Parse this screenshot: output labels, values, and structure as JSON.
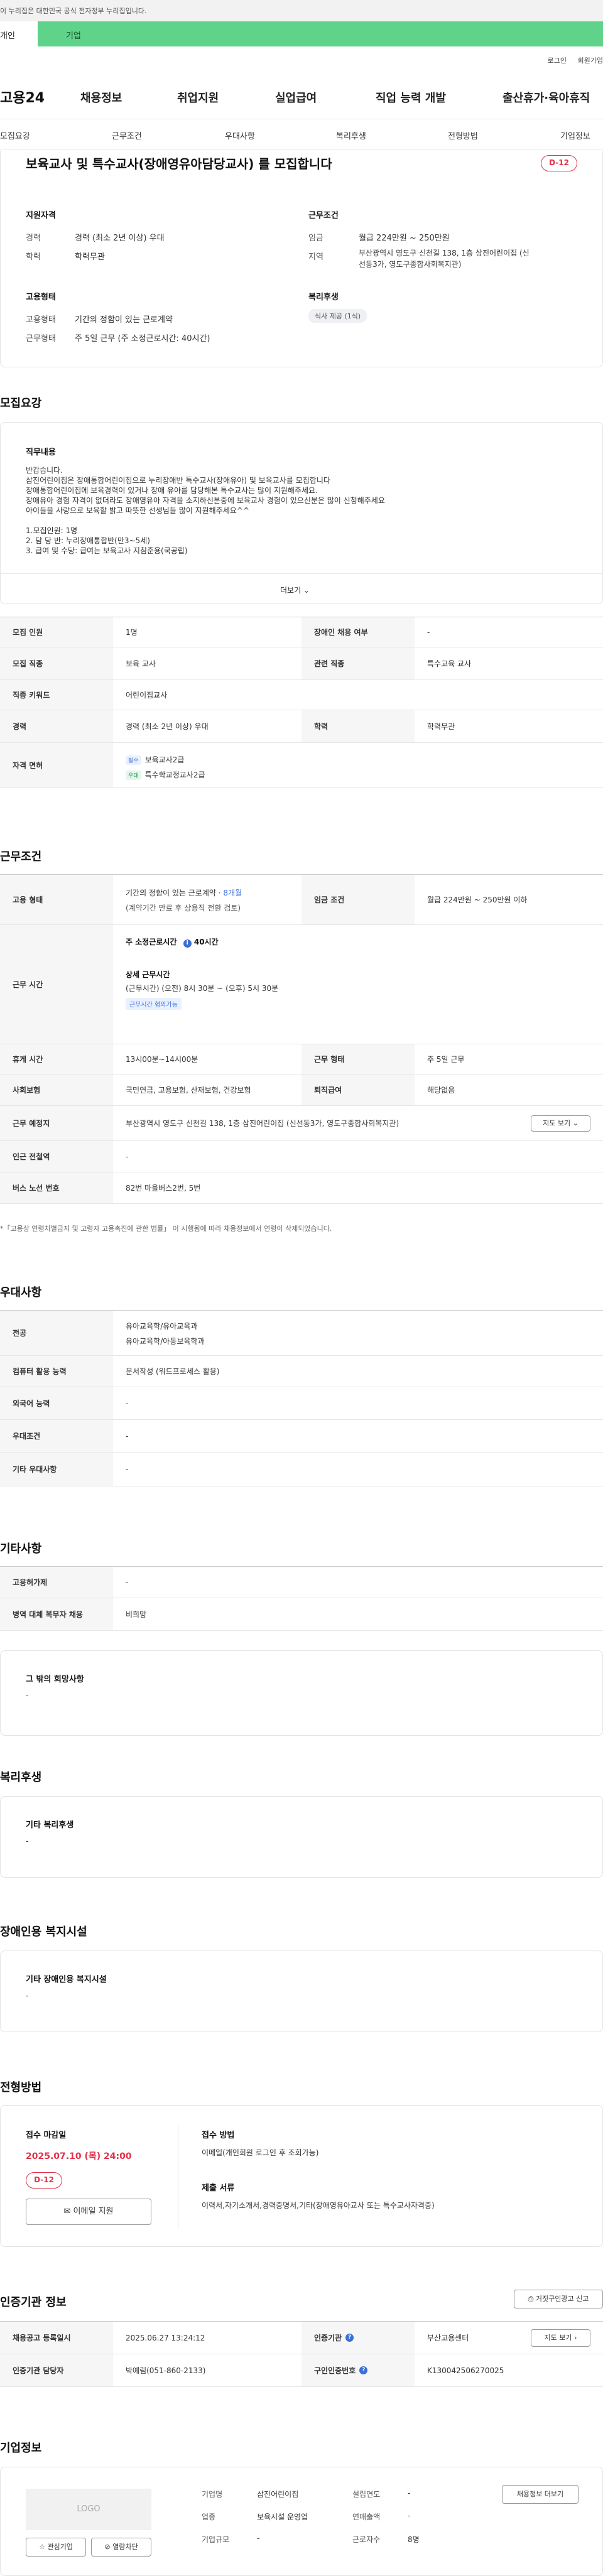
{
  "gov_banner": "이 누리집은 대한민국 공식 전자정부 누리집입니다.",
  "tabs": {
    "individual": "개인",
    "company": "기업"
  },
  "util_links": [
    "로그인",
    "회원가입"
  ],
  "brand": {
    "logo": "고용24"
  },
  "gnb": [
    "채용정보",
    "취업지원",
    "실업급여",
    "직업 능력 개발",
    "출산휴가·육아휴직"
  ],
  "anchor_nav": [
    "모집요강",
    "근무조건",
    "우대사항",
    "복리후생",
    "전형방법",
    "기업정보"
  ],
  "summary": {
    "title": "보육교사 및 특수교사(장애영유아담당교사) 를 모집합니다",
    "dday": "D-12",
    "qualification": {
      "heading": "지원자격",
      "career_label": "경력",
      "career": "경력 (최소 2년 이상) 우대",
      "edu_label": "학력",
      "edu": "학력무관"
    },
    "conditions": {
      "heading": "근무조건",
      "pay_label": "임금",
      "pay": "월급 224만원 ~ 250만원",
      "region_label": "지역",
      "region": "부산광역시 영도구 신천길 138, 1층 삼진어린이집 (신\n선동3가, 영도구종합사회복지관)"
    },
    "employment": {
      "heading": "고용형태",
      "type_label": "고용형태",
      "type": "기간의 정함이 있는 근로계약",
      "work_label": "근무형태",
      "work": "주 5일 근무 (주 소정근로시간: 40시간)"
    },
    "welfare": {
      "heading": "복리후생",
      "tag": "식사 제공 (1식)"
    }
  },
  "recruit": {
    "title": "모집요강",
    "box_heading": "직무내용",
    "content": "반갑습니다.\n삼진어린이집은 장애통합어린이집으로 누리장애반 특수교사(장애유아) 및 보육교사를 모집합니다\n장애통합어린이집에 보육경력이 있거나 장애 유아를 담당해본 특수교사는 많이 지원해주세요.\n장애유아 경험 자격이 없더라도 장애영유아 자격을 소지하신분중에 보육교사 경험이 있으신분은 많이 신청해주세요\n아이들을 사랑으로 보육할 밝고 따뜻한 선생님들 많이 지원해주세요^^\n\n1.모집인원: 1명\n2. 담 당 반: 누리장애통합반(만3~5세)\n3. 급여 및 수당: 급여는 보육교사 지침준용(국공립)",
    "more": "더보기",
    "rows": {
      "headcount_label": "모집 인원",
      "headcount": "1명",
      "disabled_label": "장애인 채용 여부",
      "disabled": "-",
      "job_label": "모집 직종",
      "job": "보육 교사",
      "related_label": "관련 직종",
      "related": "특수교육 교사",
      "keyword_label": "직종 키워드",
      "keyword": "어린이집교사",
      "career_label": "경력",
      "career": "경력 (최소 2년 이상) 우대",
      "edu_label": "학력",
      "edu": "학력무관",
      "license_label": "자격 면허",
      "license_badge_1": "필수",
      "license_1": "보육교사2급",
      "license_badge_2": "우대",
      "license_2": "특수학교정교사2급"
    }
  },
  "workcond": {
    "title": "근무조건",
    "emp_label": "고용 형태",
    "emp_type": "기간의 정함이 있는 근로계약",
    "emp_period": "· 8개월",
    "emp_note": "(계약기간 만료 후 상용직 전환 검토)",
    "pay_label": "임금 조건",
    "pay": "월급 224만원 ~ 250만원 이하",
    "hours_label": "근무 시간",
    "weekly_label": "주 소정근로시간",
    "weekly_value": "40시간",
    "detail_label": "상세 근무시간",
    "detail": "(근무시간) (오전) 8시 30분 ~ (오후) 5시 30분",
    "consult_tag": "근무시간 협의가능",
    "break_label": "휴게 시간",
    "break": "13시00분~14시00분",
    "form_label": "근무 형태",
    "form": "주 5일 근무",
    "insurance_label": "사회보험",
    "insurance": "국민연금, 고용보험, 산재보험, 건강보험",
    "severance_label": "퇴직급여",
    "severance": "해당없음",
    "place_label": "근무 예정지",
    "place": "부산광역시 영도구 신천길 138, 1층 삼진어린이집 (신선동3가, 영도구종합사회복지관)",
    "map_button": "지도 보기",
    "subway_label": "인근 전철역",
    "subway": "-",
    "bus_label": "버스 노선 번호",
    "bus": "82번 마을버스2번, 5번",
    "note": "*「고용상 연령차별금지 및 고령자 고용촉진에 관한 법률」 이 시행됨에 따라 채용정보에서 연령이 삭제되었습니다."
  },
  "preference": {
    "title": "우대사항",
    "major_label": "전공",
    "major_1": "유아교육학/유아교육과",
    "major_2": "유아교육학/아동보육학과",
    "computer_label": "컴퓨터 활용 능력",
    "computer": "문서작성 (워드프로세스 활용)",
    "language_label": "외국어 능력",
    "language": "-",
    "pref_label": "우대조건",
    "pref": "-",
    "other_label": "기타 우대사항",
    "other": "-"
  },
  "etc": {
    "title": "기타사항",
    "device_label": "고용허가제",
    "device": "-",
    "military_label": "병역 대체 복무자 채용",
    "military": "비희망",
    "wish_heading": "그 밖의 희망사항",
    "wish": "-"
  },
  "welfare": {
    "title": "복리후생",
    "heading": "기타 복리후생",
    "value": "-"
  },
  "disabled_facility": {
    "title": "장애인용 복지시설",
    "heading": "기타 장애인용 복지시설",
    "value": "-"
  },
  "selection": {
    "title": "전형방법",
    "deadline_label": "접수 마감일",
    "deadline": "2025.07.10 (목) 24:00",
    "dday": "D-12",
    "apply_button": "이메일 지원",
    "method_label": "접수 방법",
    "method": "이메일(개인회원 로그인 후 조회가능)",
    "docs_label": "제출 서류",
    "docs": "이력서,자기소개서,경력증명서,기타(장애영유아교사 또는 특수교사자격증)"
  },
  "auth": {
    "title": "인증기관 정보",
    "print_button": "거짓구인광고 신고",
    "date_label": "채용공고 등록일시",
    "date": "2025.06.27 13:24:12",
    "org_label": "인증기관",
    "org": "부산고용센터",
    "map_button": "지도 보기",
    "manager_label": "인증기관 담당자",
    "manager": "박예림(051-860-2133)",
    "number_label": "구인인증번호",
    "number": "K130042506270025"
  },
  "company": {
    "title": "기업정보",
    "logo_placeholder": "LOGO",
    "interest_button": "관심기업",
    "block_button": "열람차단",
    "name_label": "기업명",
    "name": "삼진어린이집",
    "industry_label": "업종",
    "industry": "보육시설 운영업",
    "size_label": "기업규모",
    "size": "-",
    "founded_label": "설립연도",
    "founded": "-",
    "sales_label": "연매출액",
    "sales": "-",
    "employees_label": "근로자수",
    "employees": "8명",
    "jobs_button": "채용정보 더보기"
  }
}
